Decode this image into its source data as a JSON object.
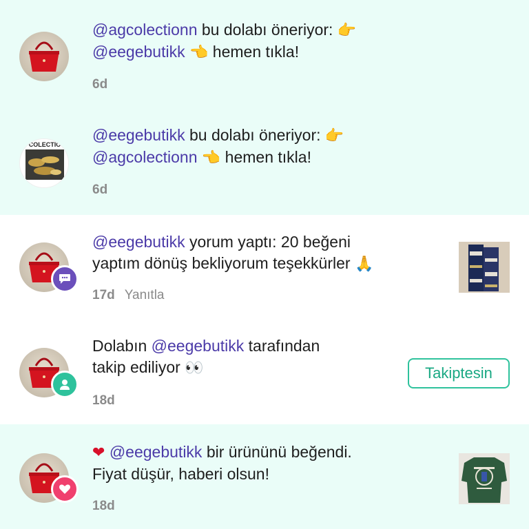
{
  "notifications": [
    {
      "line1_mention": "@agcolectionn",
      "line1_text": " bu dolabı öneriyor: ",
      "line1_emoji": "👉",
      "line2_mention": "@eegebutikk",
      "line2_emoji": "👈",
      "line2_text": " hemen tıkla!",
      "time": "6d"
    },
    {
      "line1_mention": "@eegebutikk",
      "line1_text": " bu dolabı öneriyor: ",
      "line1_emoji": "👉",
      "line2_mention": "@agcolectionn",
      "line2_emoji": "👈",
      "line2_text": " hemen tıkla!",
      "avatar_text": "COLECTIO",
      "time": "6d"
    },
    {
      "line1_mention": "@eegebutikk",
      "line1_text": " yorum yaptı: 20 beğeni",
      "line2_text": "yaptım dönüş bekliyorum teşekkürler ",
      "line2_emoji": "🙏",
      "time": "17d",
      "reply_label": "Yanıtla",
      "badge_icon": "comment-icon",
      "badge_color": "#6b4fbb"
    },
    {
      "line1_text_before": "Dolabın ",
      "line1_mention": "@eegebutikk",
      "line1_text_after": " tarafından",
      "line2_text": "takip ediliyor ",
      "line2_emoji": "👀",
      "time": "18d",
      "button_label": "Takiptesin",
      "badge_icon": "user-icon",
      "badge_color": "#2ec29c"
    },
    {
      "line1_emoji": "❤",
      "line1_mention": "@eegebutikk",
      "line1_text": " bir ürününü beğendi.",
      "line2_text": "Fiyat düşür, haberi olsun!",
      "time": "18d",
      "badge_icon": "heart-icon",
      "badge_color": "#f0406e"
    }
  ],
  "colors": {
    "unread_bg": "#eafdf8",
    "mention": "#4b3aa8",
    "accent_green": "#2ec29c",
    "heart_red": "#d8102a"
  }
}
